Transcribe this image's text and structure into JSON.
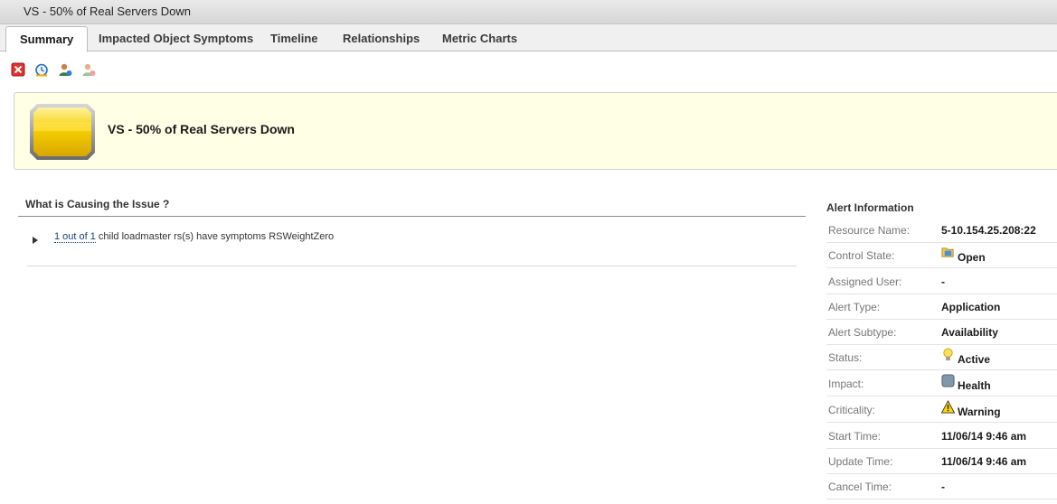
{
  "window": {
    "title": "VS - 50% of Real Servers Down"
  },
  "tabs": [
    {
      "label": "Summary",
      "active": true
    },
    {
      "label": "Impacted Object Symptoms"
    },
    {
      "label": "Timeline"
    },
    {
      "label": "Relationships"
    },
    {
      "label": "Metric Charts"
    }
  ],
  "toolbar": {
    "icons": [
      "cancel-alert-icon",
      "suspend-alert-icon",
      "take-ownership-icon",
      "release-ownership-icon"
    ]
  },
  "banner": {
    "title": "VS - 50% of Real Servers Down",
    "badge_color": "#f2c200"
  },
  "cause": {
    "heading": "What is Causing the Issue ?",
    "items": [
      {
        "link": "1 out of 1",
        "text": " child loadmaster rs(s) have symptoms RSWeightZero"
      }
    ]
  },
  "alert_info": {
    "heading": "Alert Information",
    "rows": [
      {
        "key": "Resource Name:",
        "value": "5-10.154.25.208:22"
      },
      {
        "key": "Control State:",
        "value": "Open",
        "icon": "folder-open-icon"
      },
      {
        "key": "Assigned User:",
        "value": "-"
      },
      {
        "key": "Alert Type:",
        "value": "Application"
      },
      {
        "key": "Alert Subtype:",
        "value": "Availability"
      },
      {
        "key": "Status:",
        "value": "Active",
        "icon": "lightbulb-icon"
      },
      {
        "key": "Impact:",
        "value": "Health",
        "icon": "health-icon"
      },
      {
        "key": "Criticality:",
        "value": "Warning",
        "icon": "warning-icon"
      },
      {
        "key": "Start Time:",
        "value": "11/06/14 9:46 am"
      },
      {
        "key": "Update Time:",
        "value": "11/06/14 9:46 am"
      },
      {
        "key": "Cancel Time:",
        "value": "-"
      }
    ]
  }
}
